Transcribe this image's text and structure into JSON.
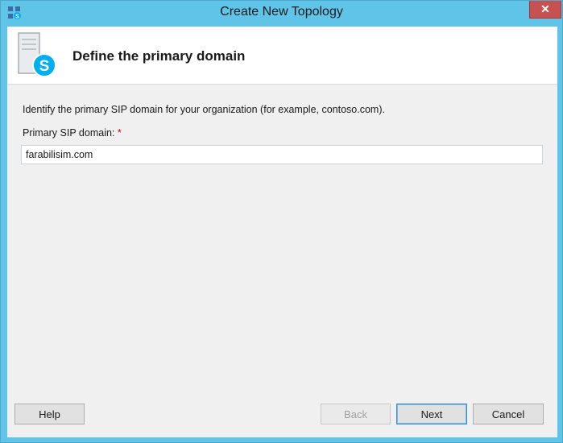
{
  "window": {
    "title": "Create New Topology",
    "close_glyph": "✕",
    "app_icon": "lync-topology-icon"
  },
  "header": {
    "title": "Define the primary domain",
    "icon": "skype-server-icon"
  },
  "form": {
    "instruction": "Identify the primary SIP domain for your organization (for example, contoso.com).",
    "field_label": "Primary SIP domain:",
    "required_marker": "*",
    "sip_domain_value": "farabilisim.com"
  },
  "buttons": {
    "help": "Help",
    "back": "Back",
    "next": "Next",
    "cancel": "Cancel"
  },
  "colors": {
    "frame": "#5fc4e8",
    "close_button": "#c75050",
    "skype_blue": "#00aff0",
    "required": "#c00000"
  }
}
